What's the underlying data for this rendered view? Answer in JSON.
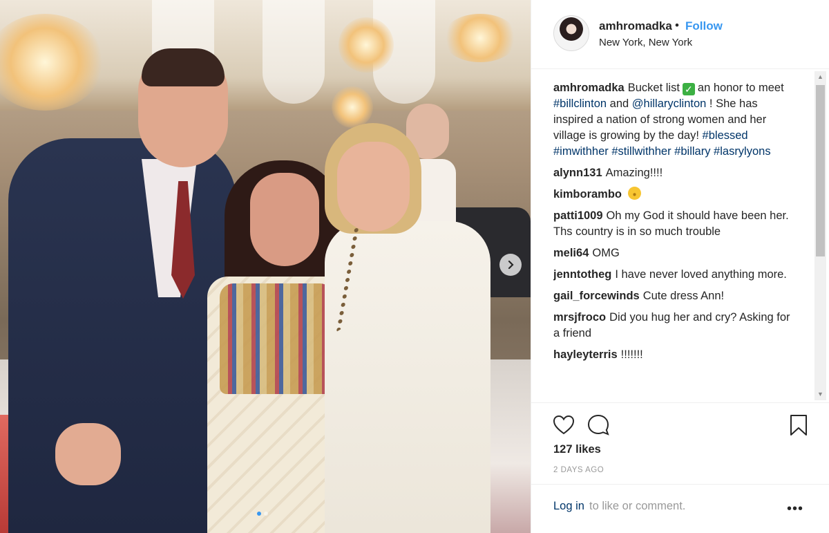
{
  "post": {
    "username": "amhromadka",
    "separator": "•",
    "follow_label": "Follow",
    "location": "New York, New York",
    "caption_user": "amhromadka",
    "caption_pre": "Bucket list",
    "caption_mid": "an honor to meet",
    "hashtag_billclinton": "#billclinton",
    "caption_and": "and",
    "mention_hillary": "@hillaryclinton",
    "caption_post": "! She has inspired a nation of strong women and her village is growing by the day!",
    "hashtag_blessed": "#blessed",
    "hashtag_imwithher": "#imwithher",
    "hashtag_stillwithher": "#stillwithher",
    "hashtag_billary": "#billary",
    "hashtag_lasrylyons": "#lasrylyons",
    "likes": "127 likes",
    "time_ago": "2 DAYS AGO",
    "login_link": "Log in",
    "login_rest": "to like or comment.",
    "more_label": "•••"
  },
  "comments": [
    {
      "user": "alynn131",
      "text": "Amazing!!!!"
    },
    {
      "user": "kimborambo",
      "text": ""
    },
    {
      "user": "patti1009",
      "text": "Oh my God it should have been her. Ths country is in so much trouble"
    },
    {
      "user": "meli64",
      "text": "OMG"
    },
    {
      "user": "jenntotheg",
      "text": "I have never loved anything more."
    },
    {
      "user": "gail_forcewinds",
      "text": "Cute dress Ann!"
    },
    {
      "user": "mrsjfroco",
      "text": "Did you hug her and cry? Asking for a friend"
    },
    {
      "user": "hayleyterris",
      "text": "!!!!!!!"
    }
  ],
  "icons": {
    "heart": "heart-icon",
    "comment": "comment-icon",
    "bookmark": "bookmark-icon",
    "next": "chevron-right-icon",
    "check": "check-box-emoji",
    "emoji": "smiley-emoji"
  },
  "carousel": {
    "total": 2,
    "active": 1
  },
  "colors": {
    "link": "#3897f0",
    "hashtag": "#003569",
    "check": "#3cb043"
  }
}
